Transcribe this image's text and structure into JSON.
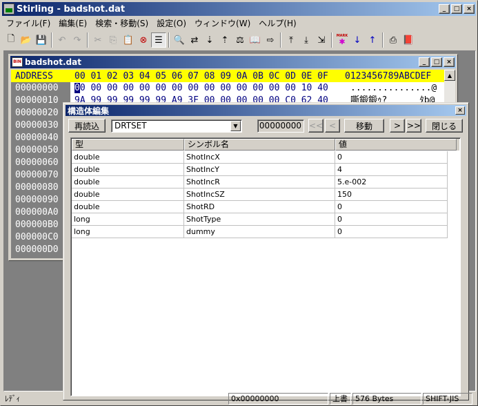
{
  "app": {
    "title": "Stirling - badshot.dat",
    "min_glyph": "_",
    "max_glyph": "□",
    "close_glyph": "×"
  },
  "menu": [
    {
      "label": "ファイル(F)"
    },
    {
      "label": "編集(E)"
    },
    {
      "label": "検索・移動(S)"
    },
    {
      "label": "設定(O)"
    },
    {
      "label": "ウィンドウ(W)"
    },
    {
      "label": "ヘルプ(H)"
    }
  ],
  "toolbar": {
    "icons": [
      {
        "icon": "new-file-icon",
        "glyph": "🗋"
      },
      {
        "icon": "open-folder-icon",
        "glyph": "📂"
      },
      {
        "icon": "save-icon",
        "glyph": "💾"
      },
      {
        "icon": "undo-icon",
        "glyph": "↶"
      },
      {
        "icon": "redo-icon",
        "glyph": "↷"
      },
      {
        "icon": "cut-icon",
        "glyph": "✂"
      },
      {
        "icon": "copy-icon",
        "glyph": "⎘"
      },
      {
        "icon": "paste-icon",
        "glyph": "📋"
      },
      {
        "icon": "delete-icon",
        "glyph": "⊗"
      },
      {
        "icon": "struct-edit-icon",
        "glyph": "☰"
      },
      {
        "icon": "find-icon",
        "glyph": "🔍"
      },
      {
        "icon": "find-replace-icon",
        "glyph": "⇄"
      },
      {
        "icon": "find-next-icon",
        "glyph": "⇣"
      },
      {
        "icon": "find-prev-icon",
        "glyph": "⇡"
      },
      {
        "icon": "compare-icon",
        "glyph": "⚖"
      },
      {
        "icon": "book-icon",
        "glyph": "📖"
      },
      {
        "icon": "jump-icon",
        "glyph": "⇨"
      },
      {
        "icon": "page-up-icon",
        "glyph": "⤒"
      },
      {
        "icon": "page-down-icon",
        "glyph": "⤓"
      },
      {
        "icon": "page-end-icon",
        "glyph": "⇲"
      },
      {
        "icon": "mark-icon",
        "glyph": "✱"
      },
      {
        "icon": "mark-next-icon",
        "glyph": "↓"
      },
      {
        "icon": "mark-prev-icon",
        "glyph": "↑"
      },
      {
        "icon": "print-icon",
        "glyph": "⎙"
      },
      {
        "icon": "help-book-icon",
        "glyph": "📕"
      }
    ],
    "mark_label": "MARK"
  },
  "doc": {
    "title": "badshot.dat",
    "bin_label": "BIN",
    "header_address": "ADDRESS",
    "header_bytes": "00 01 02 03 04 05 06 07 08 09 0A 0B 0C 0D 0E 0F",
    "header_chars": "0123456789ABCDEF",
    "addresses": [
      "00000000",
      "00000010",
      "00000020",
      "00000030",
      "00000040",
      "00000050",
      "00000060",
      "00000070",
      "00000080",
      "00000090",
      "000000A0",
      "000000B0",
      "000000C0",
      "000000D0"
    ],
    "row0_caret": "0",
    "row0_rest": "0 00 00 00 00 00 00 00 00 00 00 00 00 00 10 40",
    "row0_chars": "...............@",
    "row1_bytes": "9A 99 99 99 99 99 A9 3F 00 00 00 00 00 C0 62 40",
    "row1_chars": "嘶鍛鍛ｩ?      ﾀb@"
  },
  "dialog": {
    "title": "構造体編集",
    "reload_label": "再読込",
    "struct_name": "DRTSET",
    "offset": "00000000",
    "first_label": "<<",
    "prev_label": "<",
    "move_label": "移動",
    "next_label": ">",
    "last_label": ">>",
    "close_label": "閉じる",
    "columns": [
      "型",
      "シンボル名",
      "値"
    ],
    "rows": [
      {
        "type": "double",
        "symbol": "ShotIncX",
        "value": "0"
      },
      {
        "type": "double",
        "symbol": "ShotIncY",
        "value": "4"
      },
      {
        "type": "double",
        "symbol": "ShotIncR",
        "value": "5.e-002"
      },
      {
        "type": "double",
        "symbol": "ShotIncSZ",
        "value": "150"
      },
      {
        "type": "double",
        "symbol": "ShotRD",
        "value": "0"
      },
      {
        "type": "long",
        "symbol": "ShotType",
        "value": "0"
      },
      {
        "type": "long",
        "symbol": "dummy",
        "value": "0"
      }
    ]
  },
  "status": {
    "ready": "ﾚﾃﾞｨ",
    "address": "0x00000000",
    "mode": "上書",
    "size": "576 Bytes",
    "encoding": "SHIFT-JIS"
  }
}
